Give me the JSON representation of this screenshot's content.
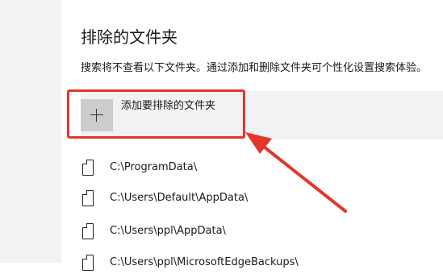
{
  "section": {
    "title": "排除的文件夹",
    "description": "搜索将不查看以下文件夹。通过添加和删除文件夹可个性化设置搜索体验。"
  },
  "add_button": {
    "label": "添加要排除的文件夹",
    "icon": "plus-icon"
  },
  "folders": [
    {
      "path": "C:\\ProgramData\\",
      "icon": "folder-icon"
    },
    {
      "path": "C:\\Users\\Default\\AppData\\",
      "icon": "folder-icon"
    },
    {
      "path": "C:\\Users\\ppl\\AppData\\",
      "icon": "folder-icon"
    },
    {
      "path": "C:\\Users\\ppl\\MicrosoftEdgeBackups\\",
      "icon": "folder-icon"
    }
  ],
  "colors": {
    "highlight": "#e3352a",
    "add_row_bg": "#f2f2f2",
    "icon_box_bg": "#cccccc"
  }
}
